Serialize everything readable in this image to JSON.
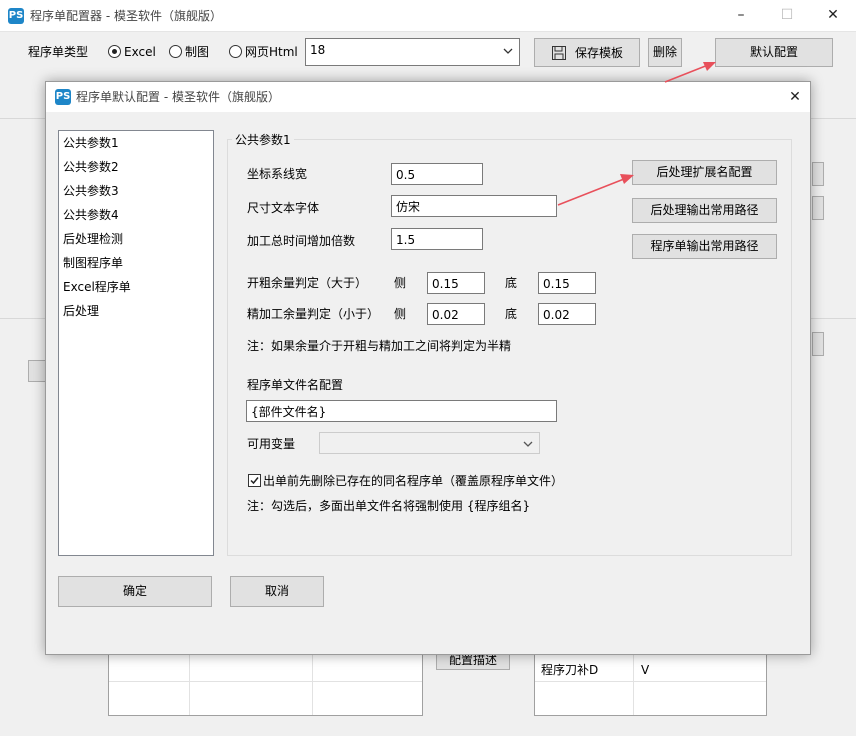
{
  "main_window": {
    "title": "程序单配置器 - 模圣软件（旗舰版）",
    "logo_text": "PS",
    "controls": {
      "minimize": "–",
      "maximize": "☐",
      "close": "✕"
    },
    "toolbar": {
      "type_label": "程序单类型",
      "radio_excel": "Excel",
      "radio_drawing": "制图",
      "radio_html": "网页Html",
      "template_value": "18",
      "save_template": "保存模板",
      "delete": "删除",
      "default_config": "默认配置"
    },
    "background": {
      "config_desc": "配置描述",
      "grid_row_label": "程序刀补D",
      "grid_row_value": "V"
    }
  },
  "dialog": {
    "title": "程序单默认配置 - 模圣软件（旗舰版）",
    "close": "✕",
    "nav_items": [
      "公共参数1",
      "公共参数2",
      "公共参数3",
      "公共参数4",
      "后处理检测",
      "制图程序单",
      "Excel程序单",
      "后处理"
    ],
    "group_title": "公共参数1",
    "fields": {
      "coord_width_label": "坐标系线宽",
      "coord_width_value": "0.5",
      "dim_font_label": "尺寸文本字体",
      "dim_font_value": "仿宋",
      "time_mult_label": "加工总时间增加倍数",
      "time_mult_value": "1.5",
      "rough_label": "开粗余量判定（大于）",
      "rough_side_label": "侧",
      "rough_side_value": "0.15",
      "rough_bottom_label": "底",
      "rough_bottom_value": "0.15",
      "finish_label": "精加工余量判定（小于）",
      "finish_side_label": "侧",
      "finish_side_value": "0.02",
      "finish_bottom_label": "底",
      "finish_bottom_value": "0.02",
      "note1": "注：如果余量介于开粗与精加工之间将判定为半精",
      "filename_label": "程序单文件名配置",
      "filename_value": "{部件文件名}",
      "vars_label": "可用变量",
      "vars_value": "",
      "delete_checkbox_label": "出单前先删除已存在的同名程序单（覆盖原程序单文件）",
      "delete_checkbox_checked": true,
      "note2": "注：勾选后，多面出单文件名将强制使用 {程序组名}"
    },
    "side_buttons": {
      "ext_config": "后处理扩展名配置",
      "post_output_path": "后处理输出常用路径",
      "prog_output_path": "程序单输出常用路径"
    },
    "ok": "确定",
    "cancel": "取消"
  },
  "accent_arrow_color": "#e8505b"
}
